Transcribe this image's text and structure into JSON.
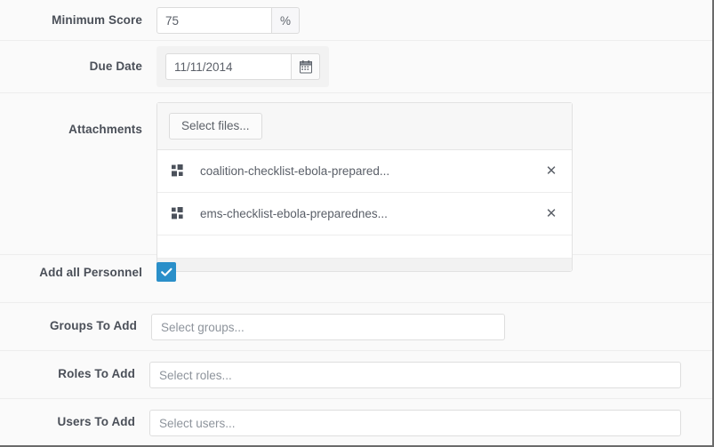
{
  "form": {
    "rows": [
      {
        "label": "Minimum Score"
      },
      {
        "label": "Due Date"
      },
      {
        "label": "Attachments"
      },
      {
        "label": "Add all Personnel"
      },
      {
        "label": "Groups To Add"
      },
      {
        "label": "Roles To Add"
      },
      {
        "label": "Users To Add"
      }
    ]
  },
  "minimum_score": {
    "label": "Minimum Score",
    "value": "75",
    "placeholder": "",
    "unit": "%"
  },
  "due_date": {
    "label": "Due Date",
    "value": "11/11/2014",
    "placeholder": "",
    "calendar_icon": "calendar-icon"
  },
  "attachments": {
    "label": "Attachments",
    "select_files_label": "Select files...",
    "files": [
      {
        "name": "coalition-checklist-ebola-prepared...",
        "grip_icon": "grid-handle-icon",
        "remove_icon": "close-icon"
      },
      {
        "name": "ems-checklist-ebola-preparednes...",
        "grip_icon": "grid-handle-icon",
        "remove_icon": "close-icon"
      }
    ]
  },
  "add_all_personnel": {
    "label": "Add all Personnel",
    "checked": true,
    "check_icon": "check-icon",
    "accent_color": "#2a8fc9"
  },
  "groups_to_add": {
    "label": "Groups To Add",
    "value": "",
    "placeholder": "Select groups..."
  },
  "roles_to_add": {
    "label": "Roles To Add",
    "value": "",
    "placeholder": "Select roles..."
  },
  "users_to_add": {
    "label": "Users To Add",
    "value": "",
    "placeholder": "Select users..."
  },
  "colors": {
    "page_background": "#fafafa",
    "label_text": "#4a4f58",
    "input_border": "#dcdcdc",
    "accent": "#2a8fc9",
    "placeholder_text": "#9aa0a8"
  }
}
